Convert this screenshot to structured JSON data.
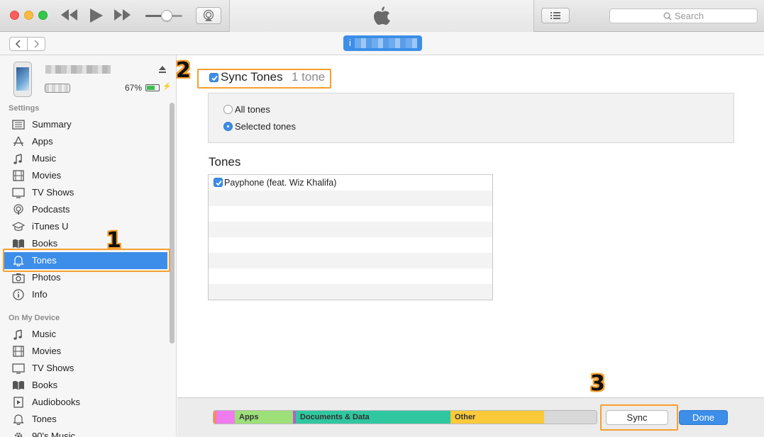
{
  "search": {
    "placeholder": "Search"
  },
  "device": {
    "pill_label": "i",
    "battery_percent": "67%",
    "battery_level": 0.67,
    "charging_glyph": "⚡"
  },
  "sidebar": {
    "settings_heading": "Settings",
    "settings_items": [
      {
        "label": "Summary",
        "icon": "summary-icon"
      },
      {
        "label": "Apps",
        "icon": "apps-icon"
      },
      {
        "label": "Music",
        "icon": "music-note-icon"
      },
      {
        "label": "Movies",
        "icon": "film-icon"
      },
      {
        "label": "TV Shows",
        "icon": "tv-icon"
      },
      {
        "label": "Podcasts",
        "icon": "podcast-icon"
      },
      {
        "label": "iTunes U",
        "icon": "graduation-cap-icon"
      },
      {
        "label": "Books",
        "icon": "book-icon"
      },
      {
        "label": "Tones",
        "icon": "bell-icon",
        "selected": true
      },
      {
        "label": "Photos",
        "icon": "camera-icon"
      },
      {
        "label": "Info",
        "icon": "info-icon"
      }
    ],
    "device_heading": "On My Device",
    "device_items": [
      {
        "label": "Music",
        "icon": "music-note-icon"
      },
      {
        "label": "Movies",
        "icon": "film-icon"
      },
      {
        "label": "TV Shows",
        "icon": "tv-icon"
      },
      {
        "label": "Books",
        "icon": "book-icon"
      },
      {
        "label": "Audiobooks",
        "icon": "audiobook-icon"
      },
      {
        "label": "Tones",
        "icon": "bell-icon"
      },
      {
        "label": "90's Music",
        "icon": "gear-icon"
      }
    ]
  },
  "main": {
    "sync_label": "Sync Tones",
    "sync_count": "1 tone",
    "sync_checked": true,
    "options": [
      {
        "label": "All tones",
        "selected": false
      },
      {
        "label": "Selected tones",
        "selected": true
      }
    ],
    "tones_heading": "Tones",
    "tones": [
      {
        "label": "Payphone (feat. Wiz Khalifa)",
        "checked": true
      }
    ]
  },
  "capacity": {
    "segments": [
      {
        "label": "",
        "color": "#f58a5f"
      },
      {
        "label": "",
        "color": "#f07bef"
      },
      {
        "label": "Apps",
        "color": "#9de07a"
      },
      {
        "label": "",
        "color": "#b560c8"
      },
      {
        "label": "Documents & Data",
        "color": "#2fc7a0"
      },
      {
        "label": "Other",
        "color": "#fbc93a"
      },
      {
        "label": "",
        "color": "#d8d8d8"
      }
    ]
  },
  "buttons": {
    "sync": "Sync",
    "done": "Done"
  },
  "annotations": {
    "step1": "1",
    "step2": "2",
    "step3": "3"
  },
  "colors": {
    "accent": "#3d8ee8",
    "highlight": "#f5a030"
  }
}
